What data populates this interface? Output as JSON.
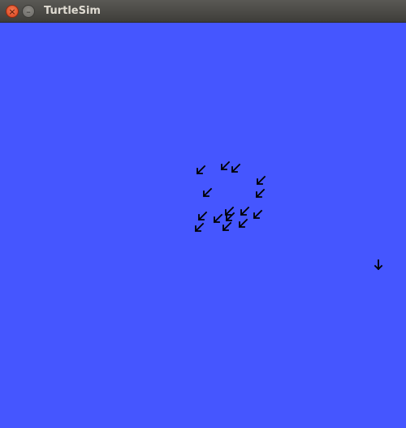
{
  "window": {
    "title": "TurtleSim",
    "close_glyph": "×",
    "minimize_glyph": "–",
    "background_color": "#4556ff",
    "turtle_color": "#000000"
  },
  "turtles": [
    {
      "heading": "down-left"
    },
    {
      "heading": "down-left"
    },
    {
      "heading": "down-left"
    },
    {
      "heading": "down-left"
    },
    {
      "heading": "down-left"
    },
    {
      "heading": "down-left"
    },
    {
      "heading": "down-left"
    },
    {
      "heading": "down-left"
    },
    {
      "heading": "down-left"
    },
    {
      "heading": "down-left"
    },
    {
      "heading": "down-left"
    },
    {
      "heading": "down-left"
    },
    {
      "heading": "down-left"
    },
    {
      "heading": "down-left"
    },
    {
      "heading": "down-left"
    },
    {
      "heading": "down"
    }
  ]
}
